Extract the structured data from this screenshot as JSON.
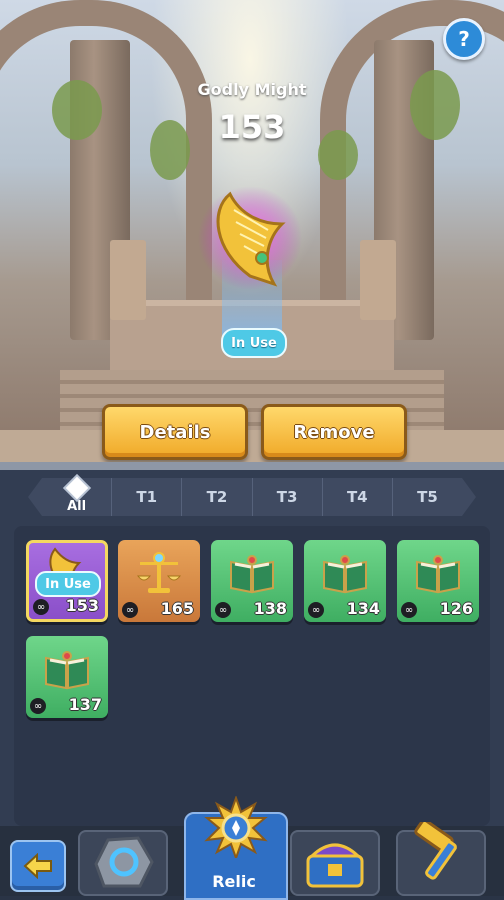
{
  "header": {
    "might_label": "Godly Might",
    "might_value": "153",
    "help_icon": "question-icon"
  },
  "relic_display": {
    "status": "In Use",
    "icon": "golden-harp-icon"
  },
  "actions": {
    "details_label": "Details",
    "remove_label": "Remove"
  },
  "tabs": [
    {
      "label": "All",
      "active": true
    },
    {
      "label": "T1",
      "active": false
    },
    {
      "label": "T2",
      "active": false
    },
    {
      "label": "T3",
      "active": false
    },
    {
      "label": "T4",
      "active": false
    },
    {
      "label": "T5",
      "active": false
    }
  ],
  "relics": [
    {
      "value": "153",
      "rarity": "purple",
      "icon": "harp-icon",
      "status": "In Use"
    },
    {
      "value": "165",
      "rarity": "orange",
      "icon": "scales-icon"
    },
    {
      "value": "138",
      "rarity": "green",
      "icon": "book-icon"
    },
    {
      "value": "134",
      "rarity": "green",
      "icon": "book-icon"
    },
    {
      "value": "126",
      "rarity": "green",
      "icon": "book-icon"
    },
    {
      "value": "137",
      "rarity": "green",
      "icon": "book-icon"
    }
  ],
  "nav": {
    "back_icon": "arrow-left-icon",
    "items": [
      {
        "icon": "rune-stone-icon"
      },
      {
        "icon": "relic-sun-icon",
        "label": "Relic"
      },
      {
        "icon": "treasure-chest-icon"
      },
      {
        "icon": "hammer-icon"
      }
    ]
  },
  "colors": {
    "accent_gold": "#f0a928",
    "accent_blue": "#2f6fc4",
    "in_use": "#4ec9e6"
  }
}
